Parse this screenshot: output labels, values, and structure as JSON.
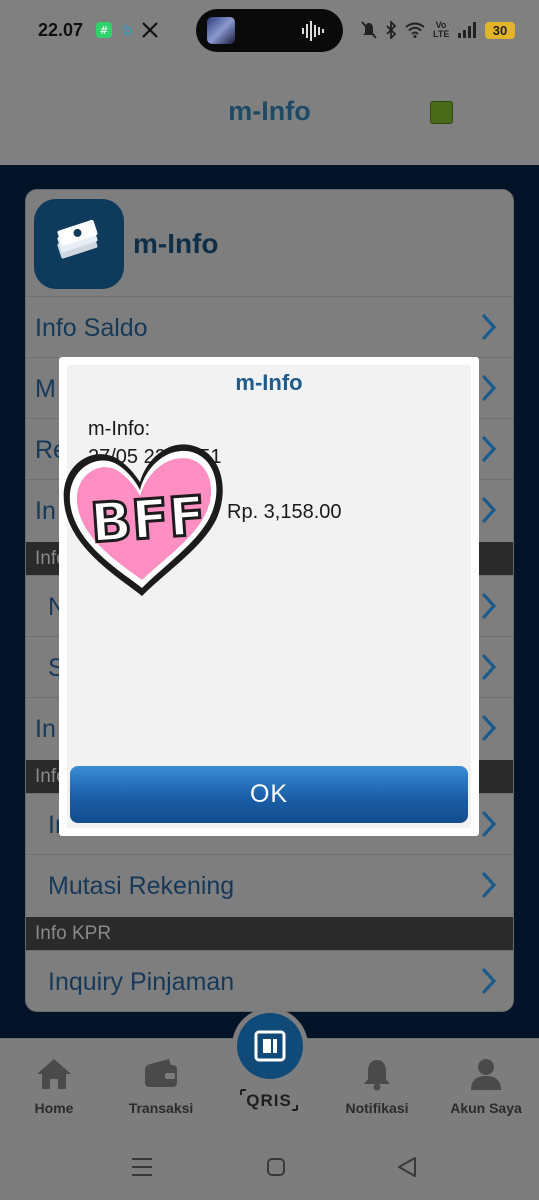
{
  "status_bar": {
    "time": "22.07",
    "battery": "30",
    "icons": [
      "notification-app-icon",
      "bluetooth-app-icon",
      "x-icon",
      "mute-icon",
      "bluetooth-icon",
      "wifi-icon",
      "volte-icon",
      "signal-icon",
      "battery-icon"
    ],
    "volte_label": "Vo LTE"
  },
  "header": {
    "title": "m-Info",
    "status_color": "#4a6a1a"
  },
  "card": {
    "title": "m-Info",
    "rows": [
      {
        "label": "Info Saldo"
      },
      {
        "label": "M"
      },
      {
        "label": "Re"
      },
      {
        "label": "In"
      }
    ],
    "sections": [
      {
        "label": "Info"
      },
      {
        "label": "Info"
      },
      {
        "label": "Info KPR"
      }
    ],
    "sub_rows_a": [
      {
        "label": "N"
      },
      {
        "label": "S"
      },
      {
        "label": "In"
      }
    ],
    "sub_rows_b": [
      {
        "label": "In"
      },
      {
        "label": "Mutasi Rekening"
      }
    ],
    "sub_rows_c": [
      {
        "label": "Inquiry Pinjaman"
      }
    ]
  },
  "dialog": {
    "title": "m-Info",
    "line1": "m-Info:",
    "line2": "27/05 22:07:51",
    "amount": "Rp. 3,158.00",
    "ok_label": "OK"
  },
  "sticker": {
    "text": "BFF"
  },
  "bottom_nav": {
    "items": [
      {
        "label": "Home",
        "icon": "home-icon"
      },
      {
        "label": "Transaksi",
        "icon": "wallet-icon"
      },
      {
        "label": "Notifikasi",
        "icon": "bell-icon"
      },
      {
        "label": "Akun Saya",
        "icon": "user-icon"
      }
    ],
    "qris_label": "QRIS"
  },
  "colors": {
    "brand_blue": "#1c5b8c",
    "ok_button": "#1a5fa8",
    "dark_bg": "#031428"
  }
}
